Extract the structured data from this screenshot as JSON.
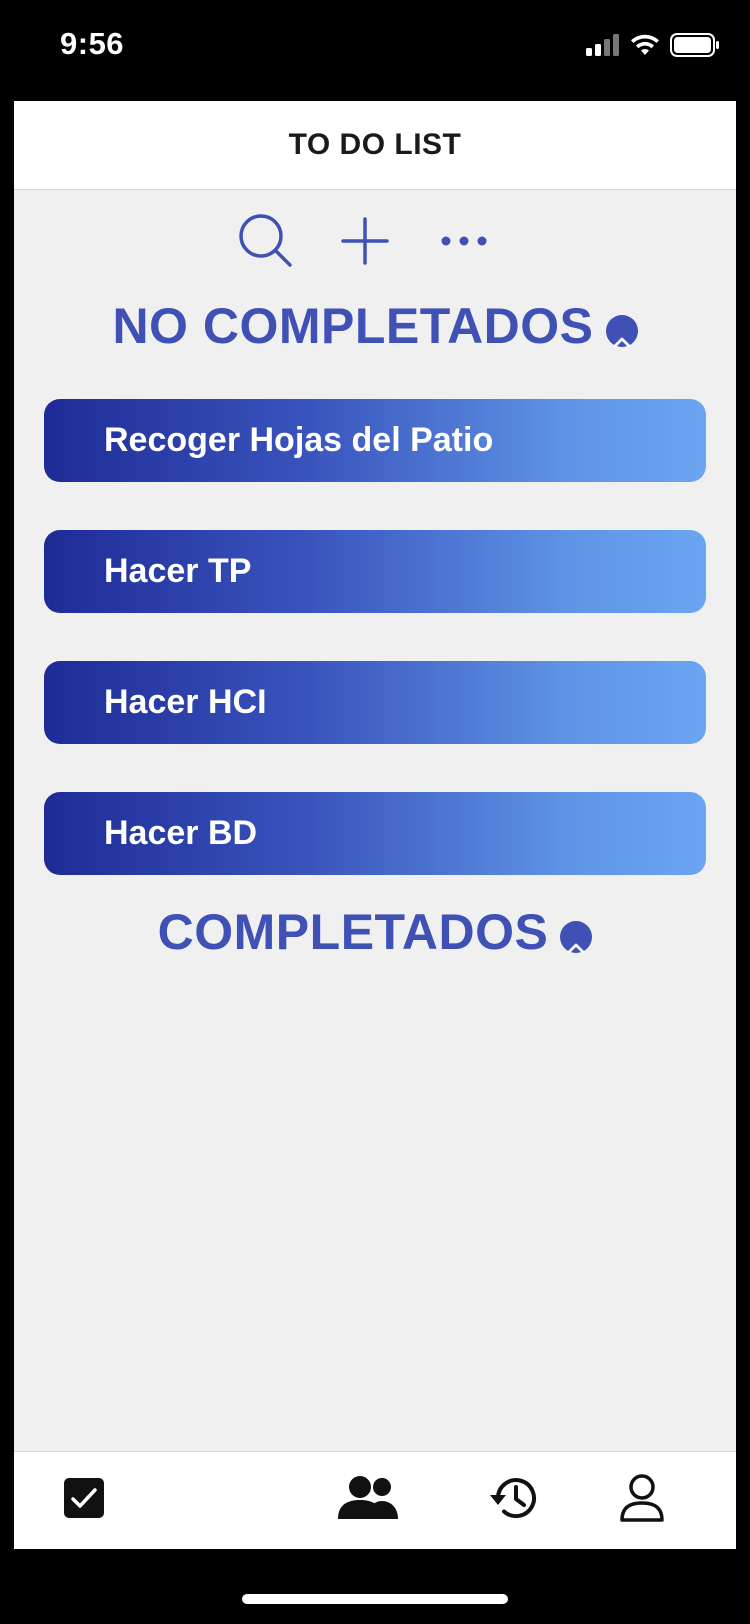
{
  "status_bar": {
    "time": "9:56"
  },
  "header": {
    "title": "TO DO LIST"
  },
  "toolbar": {
    "search_icon": "search-icon",
    "add_icon": "plus-icon",
    "more_icon": "more-horizontal-icon"
  },
  "sections": {
    "not_completed": {
      "heading": "NO COMPLETADOS"
    },
    "completed": {
      "heading": "COMPLETADOS"
    }
  },
  "tasks": [
    {
      "label": "Recoger Hojas del Patio"
    },
    {
      "label": "Hacer TP"
    },
    {
      "label": "Hacer HCI"
    },
    {
      "label": "Hacer BD"
    }
  ],
  "tab_bar": {
    "items": [
      {
        "icon": "checkbox-icon"
      },
      {
        "icon": "group-icon"
      },
      {
        "icon": "history-icon"
      },
      {
        "icon": "profile-icon"
      }
    ]
  },
  "colors": {
    "accent": "#3f51b5",
    "gradient_start": "#1e2b96",
    "gradient_end": "#6aa5f2",
    "background": "#f0f0f0"
  }
}
